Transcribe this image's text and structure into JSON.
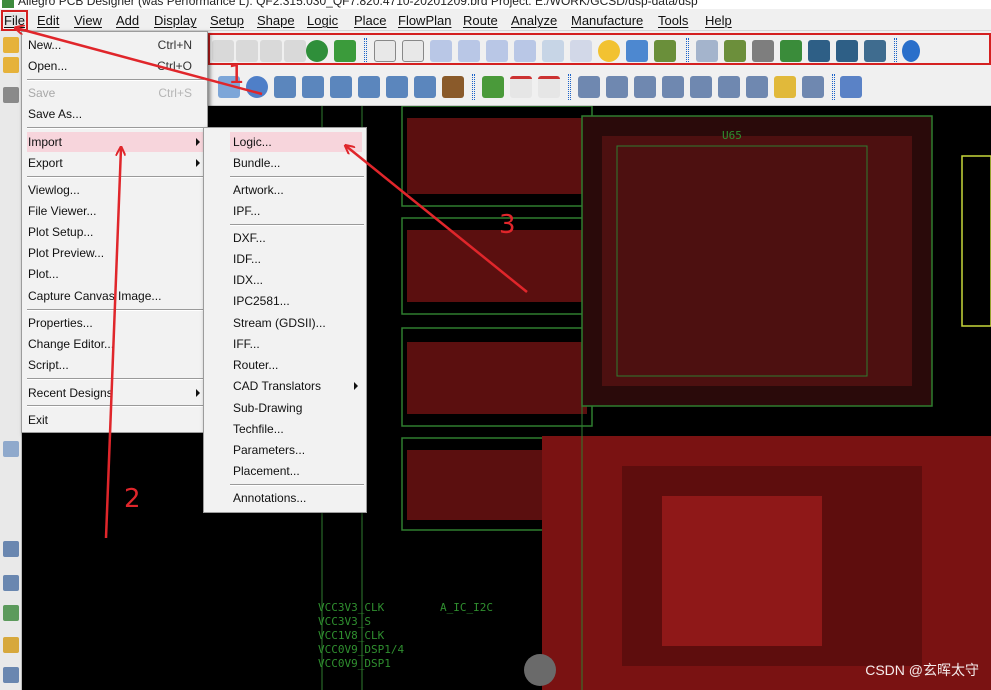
{
  "window": {
    "title": "Allegro PCB Designer (was Performance L): QF2.315.030_QF7.820.4710-20201209.brd  Project: E:/WORK/GCSD/dsp-data/dsp"
  },
  "menubar": [
    {
      "label": "File",
      "active": true
    },
    {
      "label": "Edit"
    },
    {
      "label": "View"
    },
    {
      "label": "Add"
    },
    {
      "label": "Display"
    },
    {
      "label": "Setup"
    },
    {
      "label": "Shape"
    },
    {
      "label": "Logic"
    },
    {
      "label": "Place"
    },
    {
      "label": "FlowPlan"
    },
    {
      "label": "Route"
    },
    {
      "label": "Analyze"
    },
    {
      "label": "Manufacture"
    },
    {
      "label": "Tools"
    },
    {
      "label": "Help"
    }
  ],
  "file_menu": {
    "items": [
      {
        "label": "New...",
        "shortcut": "Ctrl+N"
      },
      {
        "label": "Open...",
        "shortcut": "Ctrl+O"
      },
      {
        "label": "Save",
        "shortcut": "Ctrl+S",
        "disabled": true
      },
      {
        "label": "Save As..."
      },
      {
        "label": "Import",
        "submenu": true,
        "highlighted": true
      },
      {
        "label": "Export",
        "submenu": true
      },
      {
        "label": "Viewlog..."
      },
      {
        "label": "File Viewer..."
      },
      {
        "label": "Plot Setup..."
      },
      {
        "label": "Plot Preview..."
      },
      {
        "label": "Plot..."
      },
      {
        "label": "Capture Canvas Image..."
      },
      {
        "label": "Properties..."
      },
      {
        "label": "Change Editor..."
      },
      {
        "label": "Script..."
      },
      {
        "label": "Recent Designs",
        "submenu": true
      },
      {
        "label": "Exit"
      }
    ]
  },
  "import_submenu": {
    "items": [
      {
        "label": "Logic...",
        "highlighted": true
      },
      {
        "label": "Bundle..."
      },
      {
        "label": "Artwork..."
      },
      {
        "label": "IPF..."
      },
      {
        "label": "DXF..."
      },
      {
        "label": "IDF..."
      },
      {
        "label": "IDX..."
      },
      {
        "label": "IPC2581..."
      },
      {
        "label": "Stream (GDSII)..."
      },
      {
        "label": "IFF..."
      },
      {
        "label": "Router..."
      },
      {
        "label": "CAD Translators",
        "submenu": true
      },
      {
        "label": "Sub-Drawing"
      },
      {
        "label": "Techfile..."
      },
      {
        "label": "Parameters..."
      },
      {
        "label": "Placement..."
      },
      {
        "label": "Annotations..."
      }
    ]
  },
  "pcb_labels": {
    "bank_a": "VCC3V3_CLK",
    "bank_b": "VCC3V3_S",
    "bank_c": "VCC1V8_CLK",
    "bank_d": "VCC0V9_DSP1/4",
    "bank_e": "VCC0V9_DSP1",
    "chip_ref": "A_IC_I2C",
    "u_ref": "U65"
  },
  "annotations": {
    "step1": "1",
    "step2": "2",
    "step3": "3",
    "arrow_color": "#e0262b"
  },
  "watermark": "CSDN @玄晖太守",
  "colors": {
    "menu_highlight": "#f7d5dc",
    "canvas_bg": "#000000",
    "pcb_green": "#2f7d2f",
    "pcb_red": "#8a1212"
  },
  "icons": {
    "titlebar": "allegro-logo-icon",
    "toolbar_row1": [
      "open-folder-icon",
      "undo-icon",
      "redo-icon",
      "pin-icon",
      "grid-icon",
      "zoom-fit-icon",
      "zoom-in-icon",
      "zoom-out-icon",
      "zoom-prev-icon",
      "refresh-icon",
      "3d-icon",
      "color-icon",
      "layer-icon",
      "chart-icon",
      "info-icon"
    ],
    "toolbar_row2": [
      "rect-icon",
      "circle-icon",
      "select-icon",
      "shape-icon",
      "via-icon",
      "measure-icon",
      "route-icon",
      "camera-icon",
      "place-icon",
      "signal-icon"
    ]
  }
}
